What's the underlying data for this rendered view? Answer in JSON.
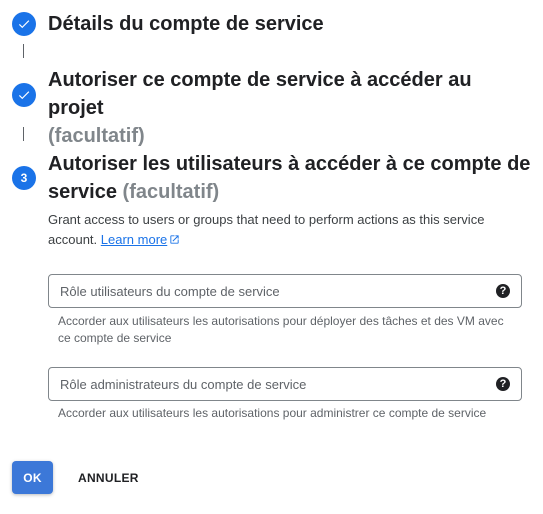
{
  "colors": {
    "accent": "#1a73e8",
    "primary_button": "#3c78d8",
    "text": "#202124",
    "muted": "#80868b"
  },
  "steps": [
    {
      "status": "completed",
      "icon": "check-icon",
      "title": "Détails du compte de service",
      "optional": ""
    },
    {
      "status": "completed",
      "icon": "check-icon",
      "title": "Autoriser ce compte de service à accéder au projet",
      "optional": "(facultatif)"
    },
    {
      "status": "active",
      "number": "3",
      "title": "Autoriser les utilisateurs à accéder à ce compte de service",
      "optional": "(facultatif)"
    }
  ],
  "description": {
    "text": "Grant access to users or groups that need to perform actions as this service account.",
    "learn_more": "Learn more",
    "learn_more_icon": "external-link-icon"
  },
  "fields": {
    "users_role": {
      "placeholder": "Rôle utilisateurs du compte de service",
      "value": "",
      "help_icon": "help-icon",
      "hint": "Accorder aux utilisateurs les autorisations pour déployer des tâches et des VM avec ce compte de service"
    },
    "admins_role": {
      "placeholder": "Rôle administrateurs du compte de service",
      "value": "",
      "help_icon": "help-icon",
      "hint": "Accorder aux utilisateurs les autorisations pour administrer ce compte de service"
    }
  },
  "actions": {
    "ok_label": "OK",
    "cancel_label": "ANNULER"
  }
}
